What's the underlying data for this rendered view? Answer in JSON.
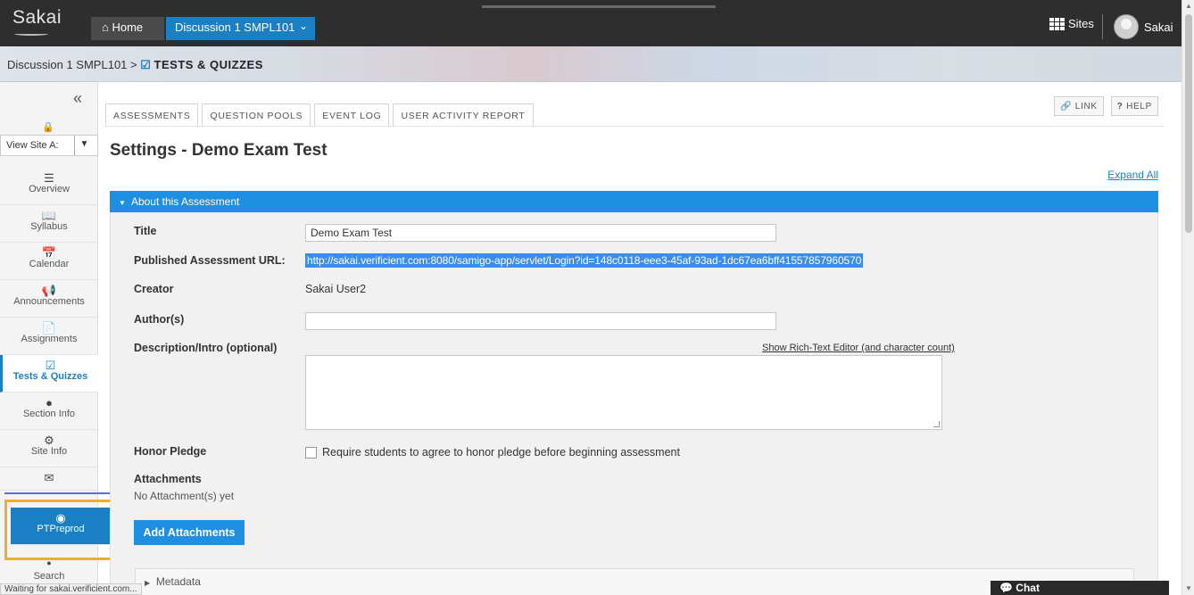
{
  "topbar": {
    "logo": "Sakai",
    "home_label": "Home",
    "site_tab": "Discussion 1 SMPL101",
    "sites_label": "Sites",
    "user_label": "Sakai"
  },
  "breadcrumb": {
    "site": "Discussion 1 SMPL101",
    "separator": ">",
    "tool": "TESTS & QUIZZES"
  },
  "leftnav": {
    "collapse": "«",
    "view_as": "View Site A:",
    "items": [
      {
        "label": "Overview",
        "icon": "list-icon"
      },
      {
        "label": "Syllabus",
        "icon": "book-icon"
      },
      {
        "label": "Calendar",
        "icon": "calendar-icon"
      },
      {
        "label": "Announcements",
        "icon": "megaphone-icon"
      },
      {
        "label": "Assignments",
        "icon": "file-icon"
      },
      {
        "label": "Tests & Quizzes",
        "icon": "checkbox-icon",
        "active": true
      },
      {
        "label": "Section Info",
        "icon": "user-icon"
      },
      {
        "label": "Site Info",
        "icon": "gear-icon"
      },
      {
        "label": "",
        "icon": "envelope-icon"
      },
      {
        "label": "PTPreprod",
        "icon": "globe-icon"
      },
      {
        "label": "Search",
        "icon": "search-icon"
      }
    ]
  },
  "tabs": [
    "ASSESSMENTS",
    "QUESTION POOLS",
    "EVENT LOG",
    "USER ACTIVITY REPORT"
  ],
  "top_buttons": {
    "link": "LINK",
    "help": "HELP"
  },
  "page_title": "Settings - Demo Exam Test",
  "expand_all": "Expand All",
  "panel": {
    "header": "About this Assessment",
    "title_label": "Title",
    "title_value": "Demo Exam Test",
    "url_label": "Published Assessment URL:",
    "url_value": "http://sakai.verificient.com:8080/samigo-app/servlet/Login?id=148c0118-eee3-45af-93ad-1dc67ea6bff41557857960570",
    "creator_label": "Creator",
    "creator_value": "Sakai User2",
    "authors_label": "Author(s)",
    "authors_value": "",
    "description_label": "Description/Intro (optional)",
    "rich_text_link": "Show Rich-Text Editor (and character count)",
    "honor_label": "Honor Pledge",
    "honor_text": "Require students to agree to honor pledge before beginning assessment",
    "attachments_label": "Attachments",
    "attachments_status": "No Attachment(s) yet",
    "add_attachments": "Add Attachments",
    "metadata": "Metadata"
  },
  "status_bar": "Waiting for sakai.verificient.com...",
  "chat": "Chat",
  "colors": {
    "accent": "#1e8fe1",
    "topbar": "#2e2e2e",
    "highlight": "#f0ad2a"
  }
}
